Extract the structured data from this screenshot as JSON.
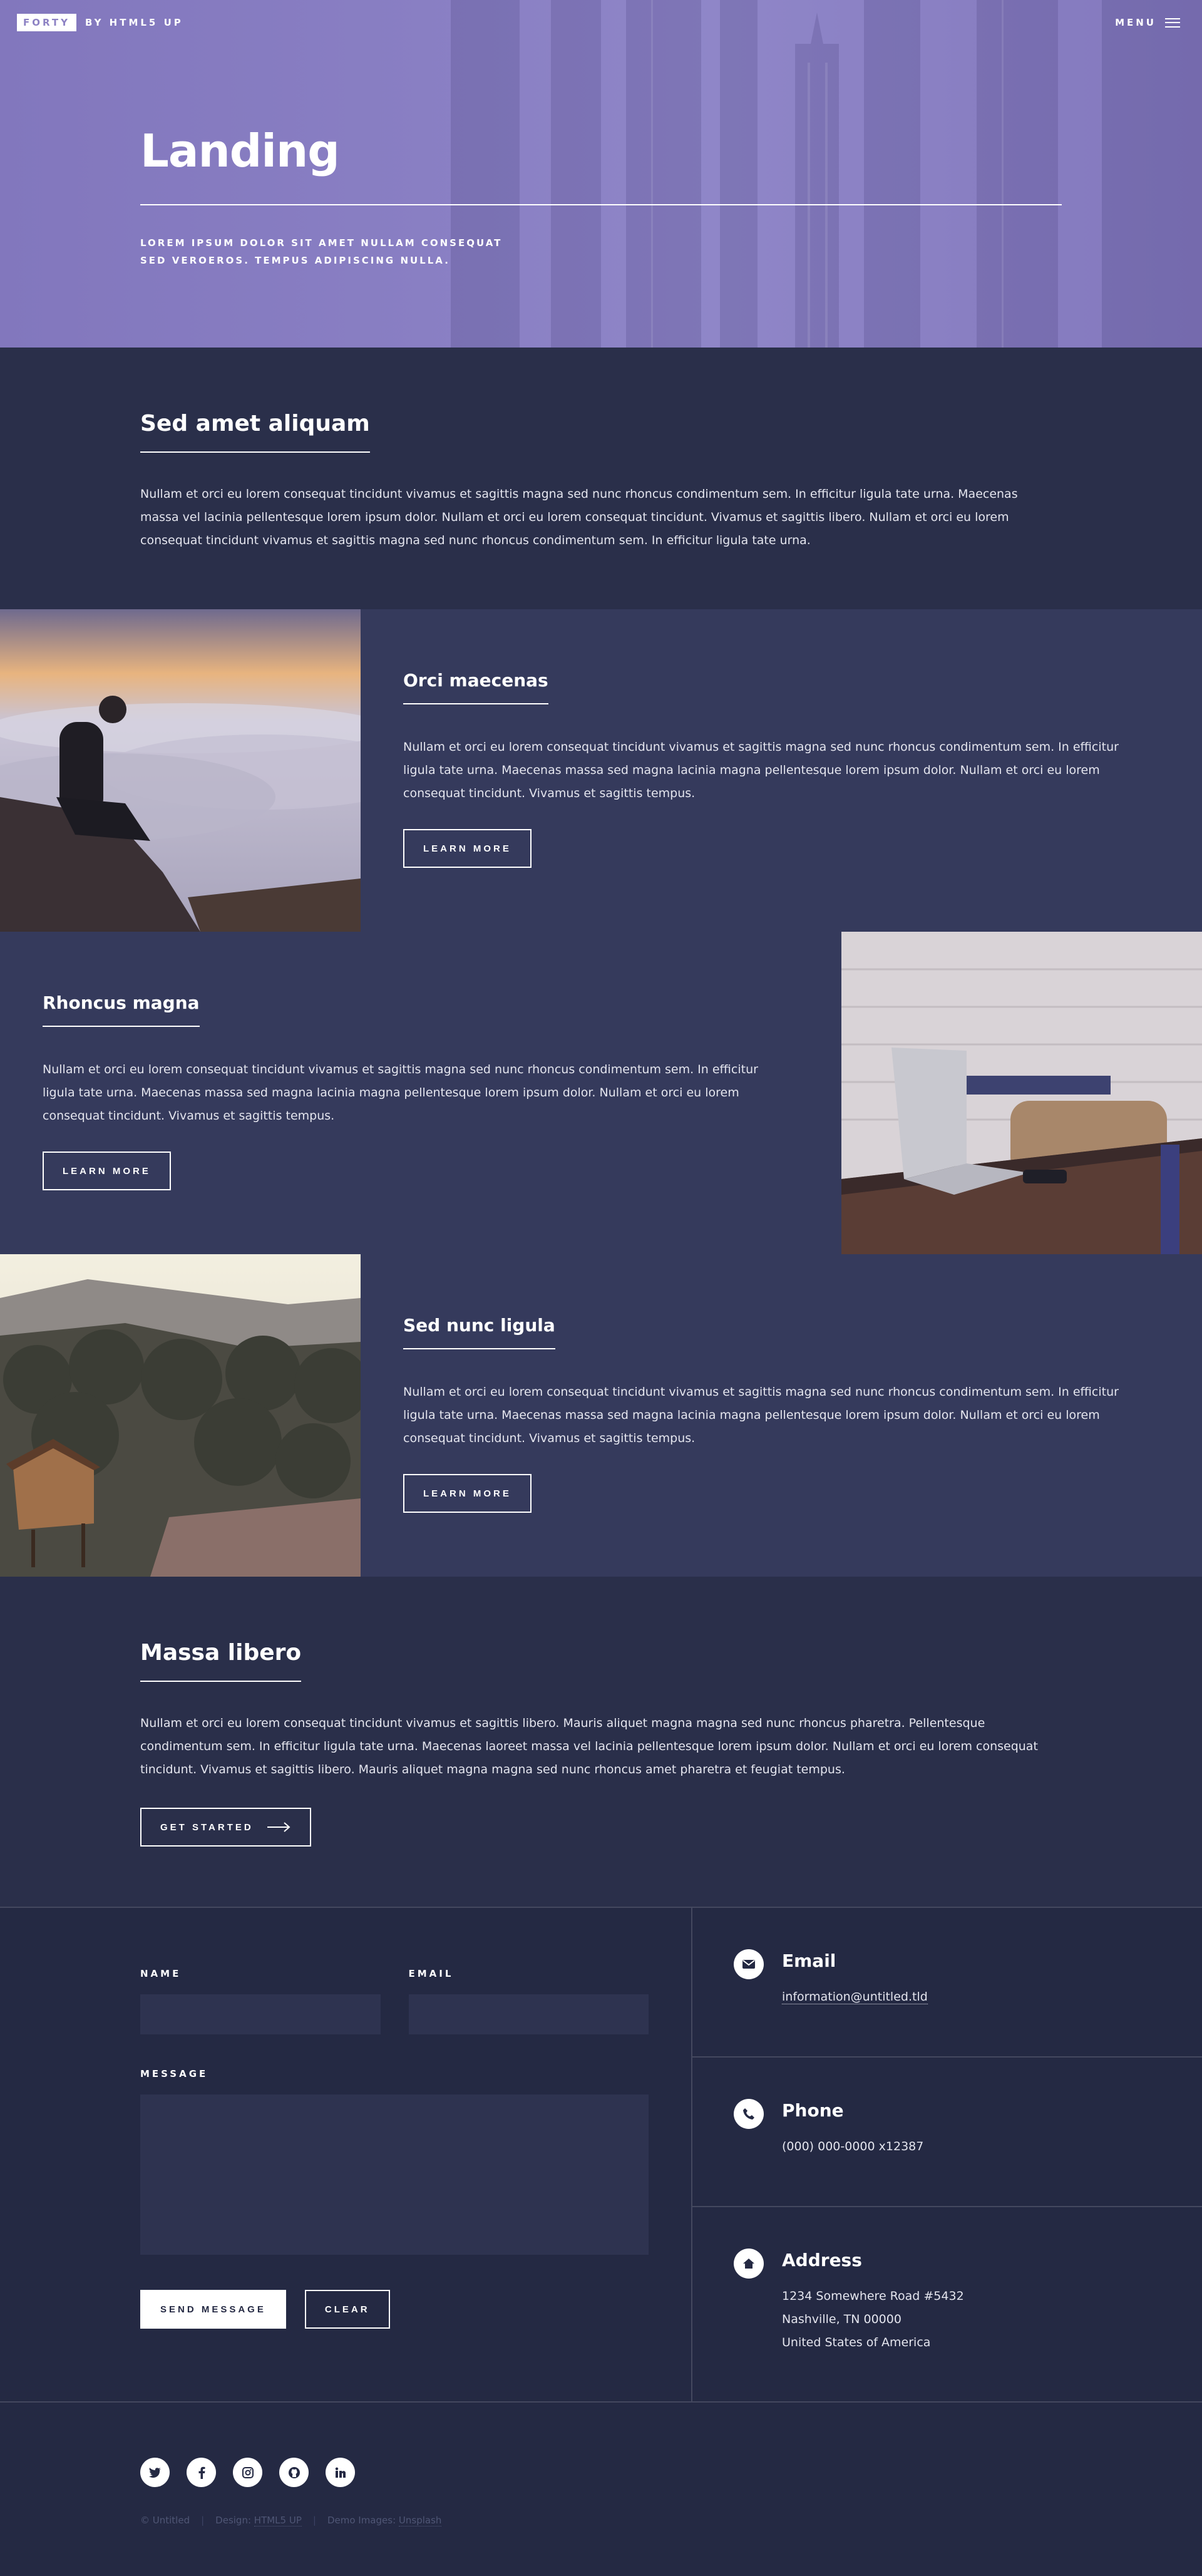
{
  "header": {
    "logo_box": "FORTY",
    "logo_by": "BY HTML5 UP",
    "menu_label": "MENU",
    "menu_icon": "hamburger-icon"
  },
  "banner": {
    "title": "Landing",
    "subtitle_line1": "LOREM IPSUM DOLOR SIT AMET NULLAM CONSEQUAT",
    "subtitle_line2": "SED VEROEROS. TEMPUS ADIPISCING NULLA."
  },
  "one": {
    "title": "Sed amet aliquam",
    "text": "Nullam et orci eu lorem consequat tincidunt vivamus et sagittis magna sed nunc rhoncus condimentum sem. In efficitur ligula tate urna. Maecenas massa vel lacinia pellentesque lorem ipsum dolor. Nullam et orci eu lorem consequat tincidunt. Vivamus et sagittis libero. Nullam et orci eu lorem consequat tincidunt vivamus et sagittis magna sed nunc rhoncus condimentum sem. In efficitur ligula tate urna."
  },
  "spotlights": [
    {
      "title": "Orci maecenas",
      "text": "Nullam et orci eu lorem consequat tincidunt vivamus et sagittis magna sed nunc rhoncus condimentum sem. In efficitur ligula tate urna. Maecenas massa sed magna lacinia magna pellentesque lorem ipsum dolor. Nullam et orci eu lorem consequat tincidunt. Vivamus et sagittis tempus.",
      "button": "LEARN MORE",
      "image": "person-above-clouds"
    },
    {
      "title": "Rhoncus magna",
      "text": "Nullam et orci eu lorem consequat tincidunt vivamus et sagittis magna sed nunc rhoncus condimentum sem. In efficitur ligula tate urna. Maecenas massa sed magna lacinia magna pellentesque lorem ipsum dolor. Nullam et orci eu lorem consequat tincidunt. Vivamus et sagittis tempus.",
      "button": "LEARN MORE",
      "image": "laptop-on-desk"
    },
    {
      "title": "Sed nunc ligula",
      "text": "Nullam et orci eu lorem consequat tincidunt vivamus et sagittis magna sed nunc rhoncus condimentum sem. In efficitur ligula tate urna. Maecenas massa sed magna lacinia magna pellentesque lorem ipsum dolor. Nullam et orci eu lorem consequat tincidunt. Vivamus et sagittis tempus.",
      "button": "LEARN MORE",
      "image": "cabin-in-forest"
    }
  ],
  "three": {
    "title": "Massa libero",
    "text": "Nullam et orci eu lorem consequat tincidunt vivamus et sagittis libero. Mauris aliquet magna magna sed nunc rhoncus pharetra. Pellentesque condimentum sem. In efficitur ligula tate urna. Maecenas laoreet massa vel lacinia pellentesque lorem ipsum dolor. Nullam et orci eu lorem consequat tincidunt. Vivamus et sagittis libero. Mauris aliquet magna magna sed nunc rhoncus amet pharetra et feugiat tempus.",
    "button": "GET STARTED"
  },
  "contact": {
    "name_label": "NAME",
    "email_label": "EMAIL",
    "message_label": "MESSAGE",
    "send_button": "SEND MESSAGE",
    "clear_button": "CLEAR",
    "email_title": "Email",
    "email_value": "information@untitled.tld",
    "phone_title": "Phone",
    "phone_value": "(000) 000-0000 x12387",
    "address_title": "Address",
    "address_line1": "1234 Somewhere Road #5432",
    "address_line2": "Nashville, TN 00000",
    "address_line3": "United States of America"
  },
  "footer": {
    "social_icons": [
      "twitter-icon",
      "facebook-icon",
      "instagram-icon",
      "github-icon",
      "linkedin-icon"
    ],
    "copyright": "© Untitled",
    "design_label": "Design:",
    "design_link": "HTML5 UP",
    "demo_label": "Demo Images:",
    "demo_link": "Unsplash"
  },
  "colors": {
    "banner_accent": "#8d82c4",
    "background": "#242943",
    "section_alt": "#2a2f4a",
    "spotlight": "#353a5c"
  }
}
